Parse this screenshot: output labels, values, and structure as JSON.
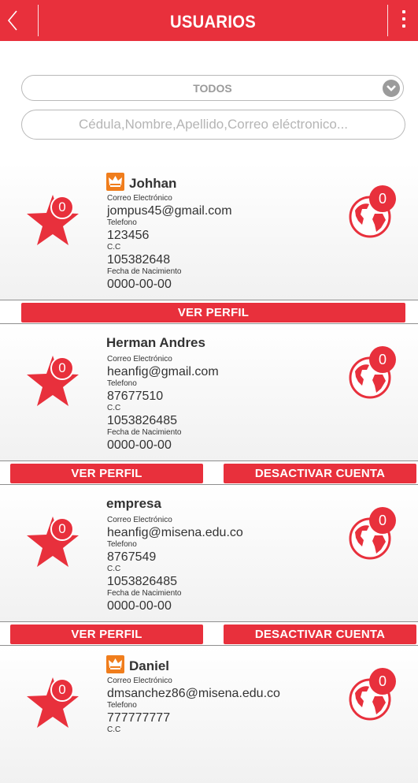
{
  "header": {
    "title": "USUARIOS"
  },
  "filter": {
    "selected": "TODOS"
  },
  "search": {
    "placeholder": "Cédula,Nombre,Apellido,Correo eléctronico..."
  },
  "labels": {
    "email": "Correo Electrónico",
    "phone": "Telefono",
    "cc": "C.C",
    "birth": "Fecha de Nacimiento"
  },
  "buttons": {
    "view_profile": "VER PERFIL",
    "deactivate": "DESACTIVAR CUENTA"
  },
  "colors": {
    "accent": "#e8303c",
    "crown": "#f07d1c"
  },
  "users": [
    {
      "name": "Johhan",
      "admin_icon": "crown-icon",
      "email": "jompus45@gmail.com",
      "phone": "123456",
      "cc": "105382648",
      "birth": "0000-00-00",
      "star_count": "0",
      "globe_count": "0"
    },
    {
      "name": "Herman Andres",
      "email": "heanfig@gmail.com",
      "phone": "87677510",
      "cc": "1053826485",
      "birth": "0000-00-00",
      "star_count": "0",
      "globe_count": "0"
    },
    {
      "name": "empresa",
      "email": "heanfig@misena.edu.co",
      "phone": "8767549",
      "cc": "1053826485",
      "birth": "0000-00-00",
      "star_count": "0",
      "globe_count": "0"
    },
    {
      "name": "Daniel",
      "admin_icon": "crown-icon",
      "email": "dmsanchez86@misena.edu.co",
      "phone": "777777777",
      "cc": "",
      "birth": "",
      "star_count": "0",
      "globe_count": "0"
    }
  ]
}
